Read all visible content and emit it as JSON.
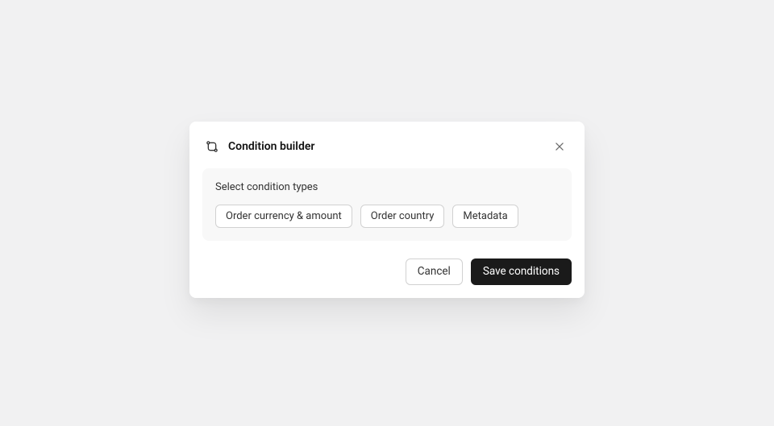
{
  "modal": {
    "title": "Condition builder",
    "section": {
      "label": "Select condition types",
      "options": [
        "Order currency & amount",
        "Order country",
        "Metadata"
      ]
    },
    "footer": {
      "cancel": "Cancel",
      "save": "Save conditions"
    }
  }
}
